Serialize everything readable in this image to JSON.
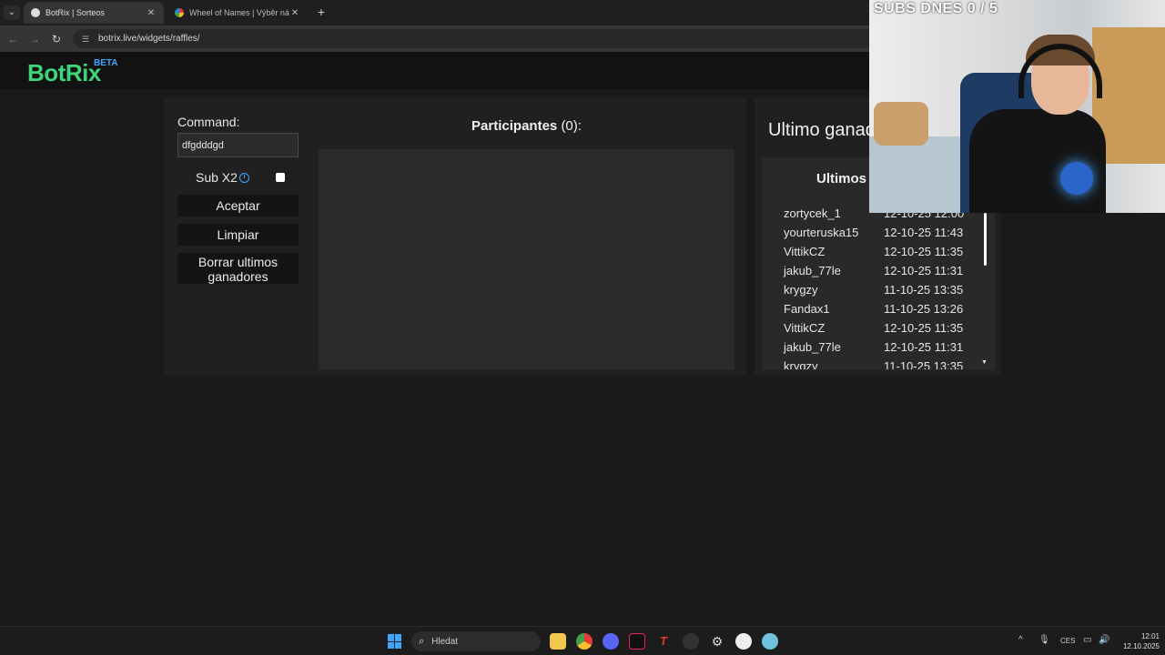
{
  "browser": {
    "tabs": [
      {
        "title": "BotRix | Sorteos",
        "active": true
      },
      {
        "title": "Wheel of Names | Výběr náhod",
        "active": false
      }
    ],
    "new_tab_label": "+",
    "url": "botrix.live/widgets/raffles/"
  },
  "app": {
    "logo": "BotRix",
    "logo_badge": "BETA",
    "accent": "#3ed47a"
  },
  "raffle": {
    "command_label": "Command:",
    "command_value": "dfgdddgd",
    "sub_x2_label": "Sub X2",
    "sub_x2_checked": false,
    "accept_label": "Aceptar",
    "clear_label": "Limpiar",
    "delete_label": "Borrar ultimos ganadores",
    "participants_label": "Participantes",
    "participants_count": "(0):"
  },
  "winners": {
    "title": "Ultimo ganad",
    "list_title": "Ultimos",
    "rows": [
      {
        "name": "zortycek_1",
        "time": "12-10-25 12:00"
      },
      {
        "name": "yourteruska15",
        "time": "12-10-25 11:43"
      },
      {
        "name": "VittikCZ",
        "time": "12-10-25 11:35"
      },
      {
        "name": "jakub_77le",
        "time": "12-10-25 11:31"
      },
      {
        "name": "krygzy",
        "time": "11-10-25 13:35"
      },
      {
        "name": "Fandax1",
        "time": "11-10-25 13:26"
      },
      {
        "name": "VittikCZ",
        "time": "12-10-25 11:35"
      },
      {
        "name": "jakub_77le",
        "time": "12-10-25 11:31"
      },
      {
        "name": "krygzy",
        "time": "11-10-25 13:35"
      }
    ]
  },
  "overlay": {
    "subs_text": "SUBS DNES  0 / 5"
  },
  "taskbar": {
    "search_placeholder": "Hledat",
    "language": "CES",
    "time": "12:01",
    "date": "12.10.2025"
  }
}
